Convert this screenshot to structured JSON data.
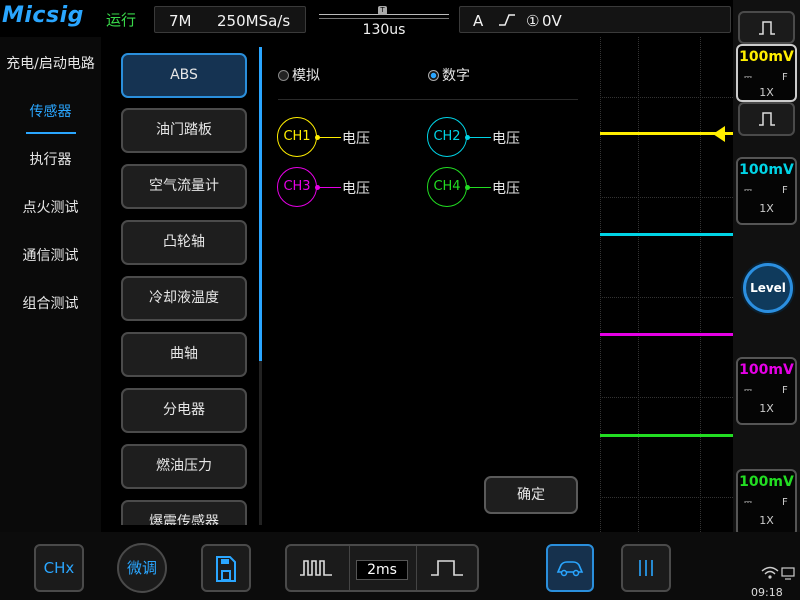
{
  "topbar": {
    "logo": "Micsig",
    "run_state": "运行",
    "memory_depth": "7M",
    "sample_rate": "250MSa/s",
    "trigger_position_marker": "T",
    "timebase_offset": "130us",
    "trigger_channel": "A",
    "trigger_edge_glyph": "⎍",
    "trigger_source": "①",
    "trigger_level": "0V"
  },
  "categories": [
    {
      "label": "充电/启动电路",
      "active": false
    },
    {
      "label": "传感器",
      "active": true
    },
    {
      "label": "执行器",
      "active": false
    },
    {
      "label": "点火测试",
      "active": false
    },
    {
      "label": "通信测试",
      "active": false
    },
    {
      "label": "组合测试",
      "active": false
    }
  ],
  "sensors": [
    {
      "label": "ABS",
      "active": true
    },
    {
      "label": "油门踏板",
      "active": false
    },
    {
      "label": "空气流量计",
      "active": false
    },
    {
      "label": "凸轮轴",
      "active": false
    },
    {
      "label": "冷却液温度",
      "active": false
    },
    {
      "label": "曲轴",
      "active": false
    },
    {
      "label": "分电器",
      "active": false
    },
    {
      "label": "燃油压力",
      "active": false
    },
    {
      "label": "爆震传感器",
      "active": false
    }
  ],
  "detail": {
    "mode_analog": "模拟",
    "mode_digital": "数字",
    "selected_mode": "数字",
    "channels": [
      {
        "name": "CH1",
        "measure": "电压",
        "color": "#ffee00"
      },
      {
        "name": "CH2",
        "measure": "电压",
        "color": "#00d4e6"
      },
      {
        "name": "CH3",
        "measure": "电压",
        "color": "#e600e6"
      },
      {
        "name": "CH4",
        "measure": "电压",
        "color": "#22dd22"
      }
    ],
    "confirm_label": "确定"
  },
  "right_panel": {
    "channels": [
      {
        "scale": "100mV",
        "coupling": "F",
        "probe": "1X",
        "color": "#ffee00"
      },
      {
        "scale": "100mV",
        "coupling": "F",
        "probe": "1X",
        "color": "#00d4e6"
      },
      {
        "scale": "100mV",
        "coupling": "F",
        "probe": "1X",
        "color": "#e600e6"
      },
      {
        "scale": "100mV",
        "coupling": "F",
        "probe": "1X",
        "color": "#22dd22"
      }
    ],
    "level_label": "Level"
  },
  "bottombar": {
    "chx_label": "CHx",
    "fine_label": "微调",
    "timebase": "2ms",
    "clock": "09:18"
  }
}
